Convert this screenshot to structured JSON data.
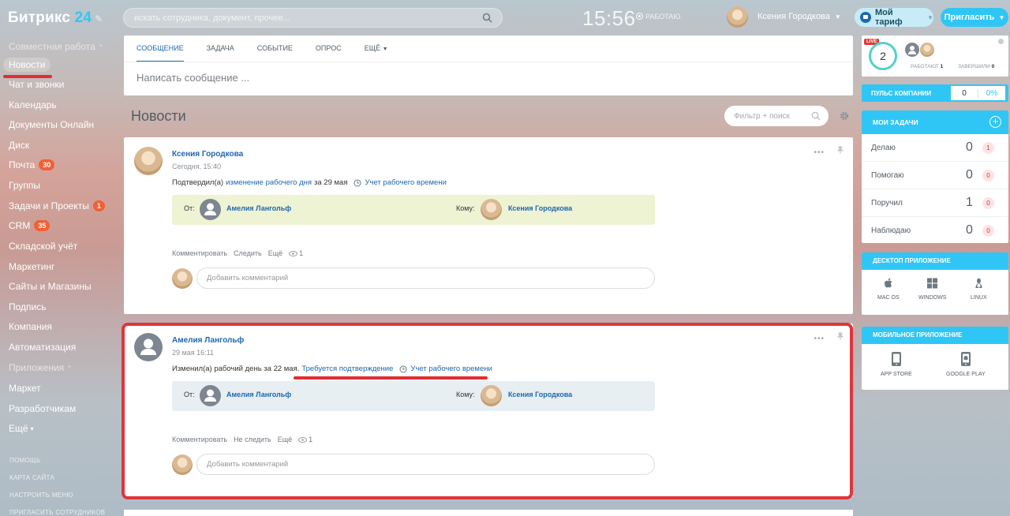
{
  "header": {
    "logo_text": "Битрикс",
    "logo_num": "24",
    "search_placeholder": "искать сотрудника, документ, прочее...",
    "clock": "15:56",
    "work_status": "РАБОТАЮ",
    "user_name": "Ксения Городкова",
    "tariff_label": "Мой тариф",
    "invite_label": "Пригласить"
  },
  "sidebar": {
    "group_collab": "Совместная работа",
    "items": [
      {
        "label": "Новости"
      },
      {
        "label": "Чат и звонки"
      },
      {
        "label": "Календарь"
      },
      {
        "label": "Документы Онлайн"
      },
      {
        "label": "Диск"
      },
      {
        "label": "Почта",
        "count": "30"
      },
      {
        "label": "Группы"
      },
      {
        "label": "Задачи и Проекты",
        "count": "1"
      },
      {
        "label": "CRM",
        "count": "35"
      },
      {
        "label": "Складской учёт"
      },
      {
        "label": "Маркетинг"
      },
      {
        "label": "Сайты и Магазины"
      },
      {
        "label": "Подпись"
      },
      {
        "label": "Компания"
      },
      {
        "label": "Автоматизация"
      }
    ],
    "group_apps": "Приложения",
    "apps": [
      {
        "label": "Маркет"
      },
      {
        "label": "Разработчикам"
      },
      {
        "label": "Ещё"
      }
    ],
    "footer": [
      "ПОМОЩЬ",
      "КАРТА САЙТА",
      "НАСТРОИТЬ МЕНЮ",
      "ПРИГЛАСИТЬ СОТРУДНИКОВ"
    ]
  },
  "postform": {
    "tabs": [
      "СООБЩЕНИЕ",
      "ЗАДАЧА",
      "СОБЫТИЕ",
      "ОПРОС",
      "ЕЩЁ"
    ],
    "write_placeholder": "Написать сообщение ..."
  },
  "feed": {
    "title": "Новости",
    "filter_placeholder": "Фильтр + поиск"
  },
  "posts": [
    {
      "author": "Ксения Городкова",
      "date": "Сегодня, 15:40",
      "text_prefix": "Подтвердил(а)",
      "link": "изменение рабочего дня",
      "text_mid": "за 29 мая",
      "timeman_link": "Учет рабочего времени",
      "from_label": "От:",
      "from_name": "Амелия Лангольф",
      "to_label": "Кому:",
      "to_name": "Ксения Городкова",
      "actions": [
        "Комментировать",
        "Следить",
        "Ещё"
      ],
      "views": "1",
      "comment_placeholder": "Добавить комментарий"
    },
    {
      "author": "Амелия Лангольф",
      "date": "29 мая 16:11",
      "text_prefix": "Изменил(а) рабочий день за 22 мая.",
      "link": "Требуется подтверждение",
      "timeman_link": "Учет рабочего времени",
      "from_label": "От:",
      "from_name": "Амелия Лангольф",
      "to_label": "Кому:",
      "to_name": "Ксения Городкова",
      "actions": [
        "Комментировать",
        "Не следить",
        "Ещё"
      ],
      "views": "1",
      "comment_placeholder": "Добавить комментарий"
    }
  ],
  "right": {
    "live_badge": "LIVE",
    "live_count": "2",
    "working_label": "РАБОТАЮТ",
    "working_count": "1",
    "finished_label": "ЗАВЕРШИЛИ",
    "finished_count": "0",
    "pulse_label": "ПУЛЬС КОМПАНИИ",
    "pulse_value": "0",
    "pulse_percent": "0%",
    "tasks_title": "МОИ ЗАДАЧИ",
    "tasks": [
      {
        "label": "Делаю",
        "value": "0",
        "badge": "1"
      },
      {
        "label": "Помогаю",
        "value": "0",
        "badge": "0"
      },
      {
        "label": "Поручил",
        "value": "1",
        "badge": "0"
      },
      {
        "label": "Наблюдаю",
        "value": "0",
        "badge": "0"
      }
    ],
    "desktop_title": "ДЕСКТОП ПРИЛОЖЕНИЕ",
    "desktop_os": [
      "MAC OS",
      "WINDOWS",
      "LINUX"
    ],
    "mobile_title": "МОБИЛЬНОЕ ПРИЛОЖЕНИЕ",
    "mobile_stores": [
      "APP STORE",
      "GOOGLE PLAY"
    ]
  },
  "colors": {
    "accent": "#2fc6f6",
    "link": "#2067b0",
    "counter": "#f26035",
    "highlight": "#e02d34"
  }
}
